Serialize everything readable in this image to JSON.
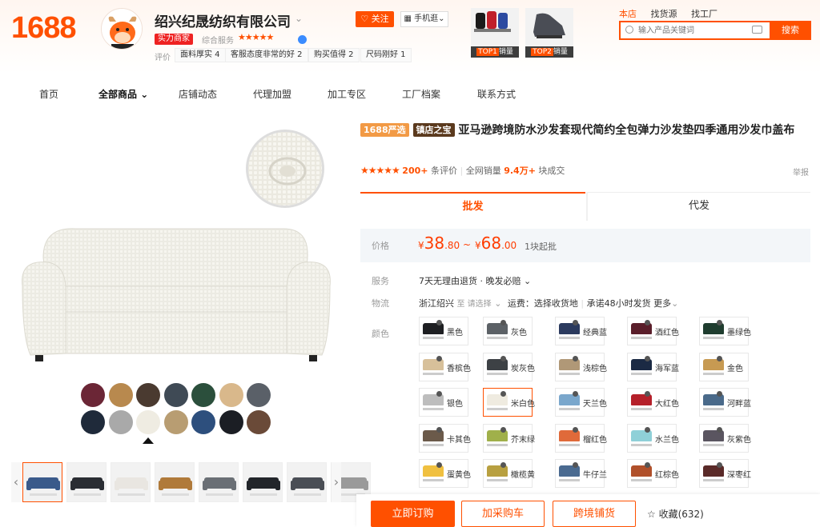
{
  "header": {
    "logo": "1688",
    "company_name": "绍兴纪晟纺织有限公司",
    "power_badge": "实力商家",
    "score_label": "综合服务",
    "score_stars": "★★★★★",
    "eval_label": "评价",
    "eval_tags": [
      "面料厚实 4",
      "客服态度非常的好 2",
      "购买值得 2",
      "尺码刚好 1"
    ],
    "follow_label": "关注",
    "mobile_label": "手机逛",
    "top_products": [
      {
        "rank": "TOP1",
        "text": "销量"
      },
      {
        "rank": "TOP2",
        "text": "销量"
      }
    ],
    "search_tabs": [
      "本店",
      "找货源",
      "找工厂"
    ],
    "search_placeholder": "输入产品关键词",
    "search_button": "搜索"
  },
  "nav": {
    "items": [
      "首页",
      "全部商品",
      "店铺动态",
      "代理加盟",
      "加工专区",
      "工厂档案",
      "联系方式"
    ],
    "active_index": 1
  },
  "gallery": {
    "swatch_colors": [
      "#6b2636",
      "#b8894e",
      "#4a3a30",
      "#3f4a55",
      "#2b4f3c",
      "#d9b88b",
      "#5a6068",
      "#1f2a3a",
      "#a9a9a9",
      "#efece2",
      "#b89d72",
      "#2d4f7d",
      "#1b1e24",
      "#6a4a38"
    ],
    "thumb_count": 8,
    "prev_arrow": "‹",
    "next_arrow": "›"
  },
  "product": {
    "badge_strict": "1688严选",
    "badge_treasure": "镇店之宝",
    "title": "亚马逊跨境防水沙发套现代简约全包弹力沙发垫四季通用沙发巾盖布",
    "stars": "★★★★★",
    "review_count": "200+",
    "review_suffix": "条评价",
    "sales_label": "全网销量",
    "sales_value": "9.4万+",
    "sales_suffix": "块成交",
    "report": "举报"
  },
  "tabs": [
    "批发",
    "代发"
  ],
  "price": {
    "label": "价格",
    "currency": "¥",
    "low_int": "38",
    "low_dec": ".80",
    "tilde": "~",
    "high_int": "68",
    "high_dec": ".00",
    "min_order": "1块起批"
  },
  "service": {
    "label": "服务",
    "text": "7天无理由退货 · 晚发必赔 ⌄"
  },
  "logistics": {
    "label": "物流",
    "origin": "浙江绍兴",
    "to_text": "至 请选择",
    "fee": "运费：选择收货地",
    "ship": "承诺48小时发货",
    "more": "更多"
  },
  "colors": {
    "label": "颜色",
    "selected_index": 11,
    "options": [
      {
        "name": "黑色",
        "hex": "#1e1f22"
      },
      {
        "name": "灰色",
        "hex": "#5c6166"
      },
      {
        "name": "经典蓝",
        "hex": "#2b3a5e"
      },
      {
        "name": "酒红色",
        "hex": "#5a1e2a"
      },
      {
        "name": "墨绿色",
        "hex": "#1f3d2f"
      },
      {
        "name": "香槟色",
        "hex": "#d7c09a"
      },
      {
        "name": "炭灰色",
        "hex": "#3d4145"
      },
      {
        "name": "浅棕色",
        "hex": "#b09877"
      },
      {
        "name": "海军蓝",
        "hex": "#1b2a44"
      },
      {
        "name": "金色",
        "hex": "#c79a52"
      },
      {
        "name": "银色",
        "hex": "#bdbdbd"
      },
      {
        "name": "米白色",
        "hex": "#efebe0"
      },
      {
        "name": "天兰色",
        "hex": "#7aa7cc"
      },
      {
        "name": "大红色",
        "hex": "#b5202a"
      },
      {
        "name": "河畔蓝",
        "hex": "#4a6a8a"
      },
      {
        "name": "卡其色",
        "hex": "#6b5a4a"
      },
      {
        "name": "芥末绿",
        "hex": "#a0b04a"
      },
      {
        "name": "榴红色",
        "hex": "#e06a3a"
      },
      {
        "name": "水兰色",
        "hex": "#8fd0d8"
      },
      {
        "name": "灰紫色",
        "hex": "#5a5560"
      },
      {
        "name": "蛋黄色",
        "hex": "#f0c040"
      },
      {
        "name": "橄榄黄",
        "hex": "#b8a040"
      },
      {
        "name": "牛仔兰",
        "hex": "#4a6a90"
      },
      {
        "name": "红棕色",
        "hex": "#b0502a"
      },
      {
        "name": "深枣红",
        "hex": "#5a2a28"
      }
    ]
  },
  "actions": {
    "buy": "立即订购",
    "cart": "加采购车",
    "cross": "跨境铺货",
    "fav": "☆ 收藏(632)"
  }
}
